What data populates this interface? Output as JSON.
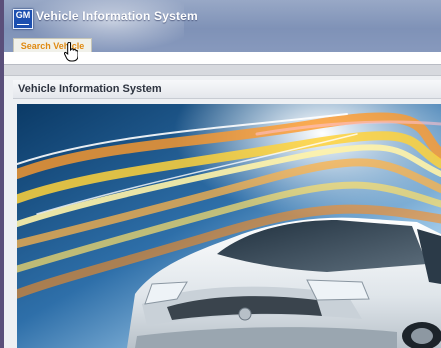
{
  "app": {
    "title": "Vehicle Information System",
    "logo_text": "GM",
    "accent": "#e08a12",
    "header_color": "#8799bd"
  },
  "toolbar": {
    "search_vehicle_label": "Search Vehicle"
  },
  "content": {
    "section_title": "Vehicle Information System",
    "hero_image": "car-with-light-streaks"
  },
  "icons": {
    "logo": "gm-logo-icon",
    "cursor": "hand-pointer-icon"
  }
}
